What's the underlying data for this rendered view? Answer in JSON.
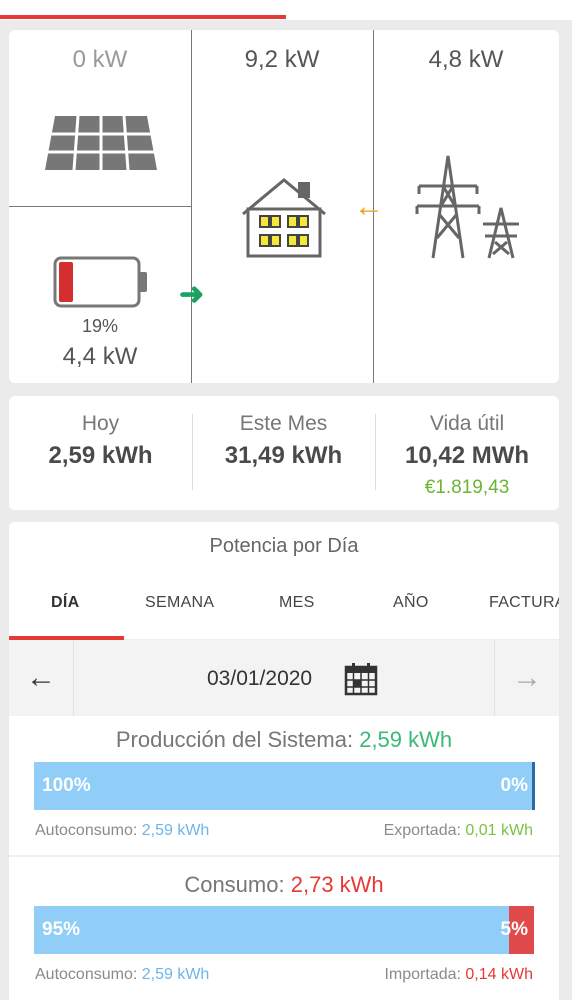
{
  "header": {
    "progress_fraction": 0.5,
    "accent_color": "#e53935"
  },
  "flow": {
    "solar_kw": "0 kW",
    "home_kw": "9,2 kW",
    "grid_kw": "4,8 kW",
    "battery_percent": "19%",
    "battery_kw": "4,4 kW",
    "battery_level": 0.19,
    "icons": [
      "solar-panel-icon",
      "battery-icon",
      "house-icon",
      "power-tower-icon"
    ],
    "arrow_battery_to_home": "➜",
    "arrow_grid_to_home": "←"
  },
  "stats": {
    "today_label": "Hoy",
    "today_value": "2,59 kWh",
    "month_label": "Este Mes",
    "month_value": "31,49 kWh",
    "life_label": "Vida útil",
    "life_value": "10,42 MWh",
    "life_money": "€1.819,43"
  },
  "power": {
    "title": "Potencia por Día",
    "tabs": [
      "DÍA",
      "SEMANA",
      "MES",
      "AÑO",
      "FACTURA"
    ],
    "active_tab": "DÍA",
    "date": "03/01/2020",
    "prev_arrow": "←",
    "next_arrow": "→",
    "production": {
      "label": "Producción del Sistema:",
      "value": "2,59 kWh",
      "left_pct": "100%",
      "right_pct": "0%",
      "self_fraction": 0.995,
      "self_label": "Autoconsumo:",
      "self_value": "2,59 kWh",
      "export_label": "Exportada:",
      "export_value": "0,01 kWh"
    },
    "consumption": {
      "label": "Consumo:",
      "value": "2,73 kWh",
      "left_pct": "95%",
      "right_pct": "5%",
      "self_fraction": 0.95,
      "self_label": "Autoconsumo:",
      "self_value": "2,59 kWh",
      "import_label": "Importada:",
      "import_value": "0,14 kWh"
    }
  },
  "colors": {
    "green": "#3cb879",
    "red": "#e53935",
    "blue": "#90cdf7",
    "money_green": "#6ab533",
    "orange": "#f39c12"
  }
}
